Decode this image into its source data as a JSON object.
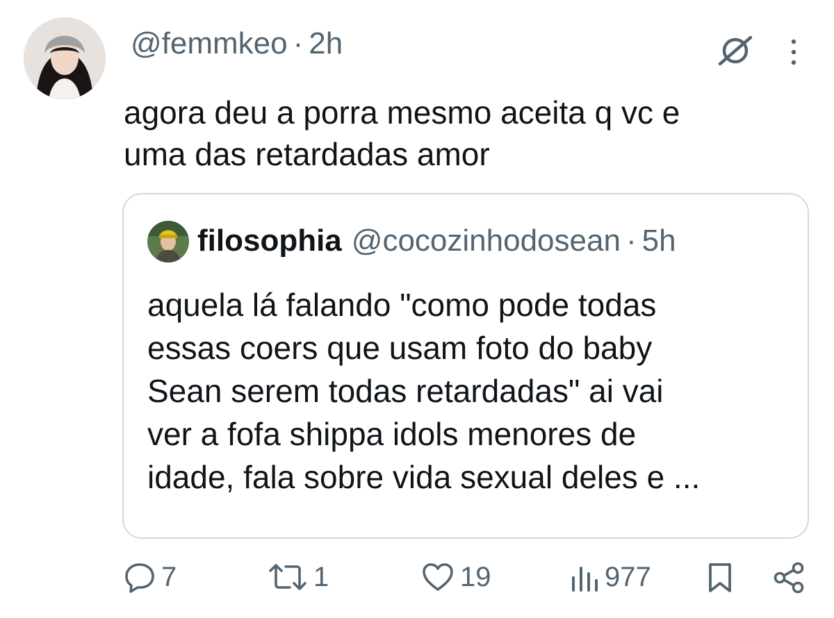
{
  "author": {
    "handle": "@femmkeo",
    "separator": "·",
    "time": "2h",
    "avatar_icon": "user-avatar-photo"
  },
  "tweet": {
    "text_line1": "agora deu a porra mesmo aceita q vc e",
    "text_line2": "uma das retardadas amor"
  },
  "quoted": {
    "name": "filosophia",
    "handle": "@cocozinhodosean",
    "separator": "·",
    "time": "5h",
    "text_lines": [
      "aquela lá falando \"como pode todas",
      "essas coers que usam foto do baby",
      "Sean serem todas retardadas\" ai vai",
      "ver a fofa shippa idols menores de",
      "idade, fala sobre vida sexual deles e ..."
    ]
  },
  "actions": {
    "replies": "7",
    "retweets": "1",
    "likes": "19",
    "views": "977"
  },
  "icons": [
    "grok-icon",
    "more-icon",
    "reply-icon",
    "retweet-icon",
    "like-icon",
    "views-icon",
    "bookmark-icon",
    "share-icon"
  ],
  "colors": {
    "text": "#0f1419",
    "secondary": "#536471",
    "border": "#cfd9de"
  }
}
